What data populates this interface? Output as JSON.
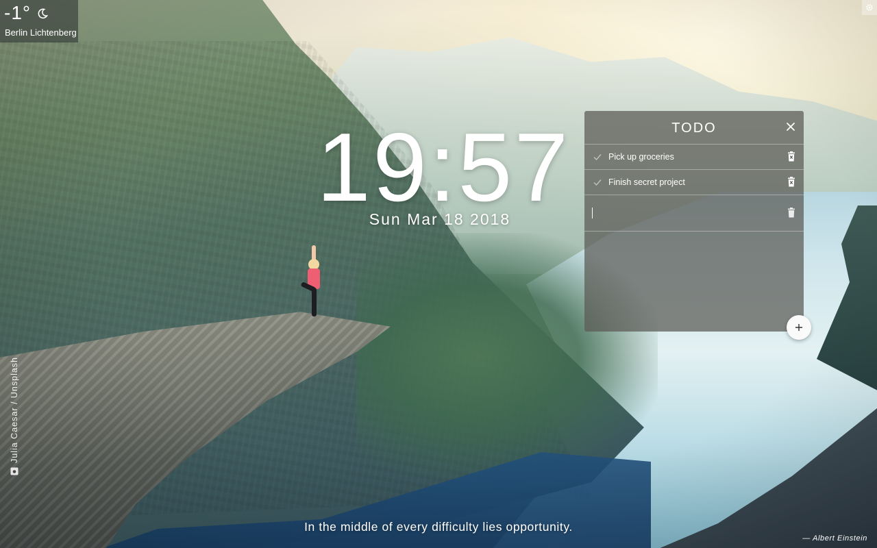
{
  "weather": {
    "temperature": "-1°",
    "icon": "moon-icon",
    "location": "Berlin Lichtenberg"
  },
  "settings": {
    "icon": "gear-icon"
  },
  "clock": {
    "time": "19:57",
    "date": "Sun Mar 18 2018"
  },
  "todo": {
    "title": "TODO",
    "items": [
      {
        "label": "Pick up groceries",
        "done": true
      },
      {
        "label": "Finish secret project",
        "done": true
      }
    ],
    "new_item": {
      "value": "",
      "placeholder": ""
    },
    "add_icon": "plus-icon",
    "close_icon": "close-icon",
    "delete_icon": "trash-icon"
  },
  "background": {
    "credit": "Julia Caesar / Unsplash",
    "credit_icon": "camera-icon"
  },
  "quote": {
    "text": "In the middle of every difficulty lies opportunity.",
    "author": "—  Albert Einstein"
  }
}
